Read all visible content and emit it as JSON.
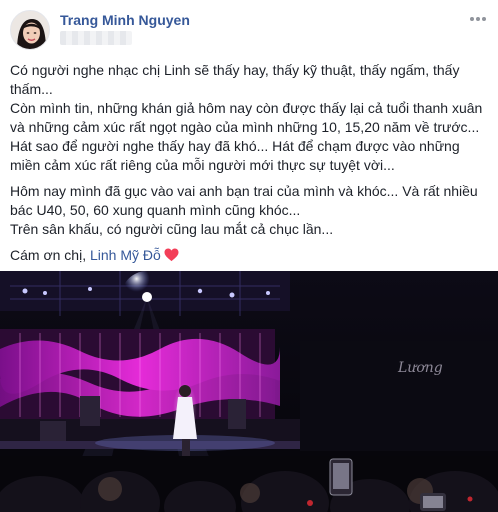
{
  "post": {
    "author_name": "Trang Minh Nguyen",
    "paragraphs": [
      {
        "lines": [
          "Có người nghe nhạc chị Linh sẽ thấy hay, thấy kỹ thuật, thấy ngấm, thấy",
          "thấm...",
          "Còn mình tin, những khán giả hôm nay còn được thấy lại cả tuổi thanh xuân",
          "và những cảm xúc rất ngọt ngào của mình những 10, 15,20 năm về trước...",
          "Hát sao để người nghe thấy hay đã khó... Hát để chạm được vào những",
          "miền cảm xúc rất riêng của mỗi người mới thực sự tuyệt vời..."
        ]
      },
      {
        "lines": [
          "Hôm nay mình đã gục vào vai anh bạn trai của mình và khóc... Và rất nhiều",
          "bác U40, 50, 60 xung quanh mình cũng khóc...",
          "Trên sân khấu, có người cũng lau mắt cả chục lần..."
        ]
      }
    ],
    "thanks_prefix": "Cám ơn chị, ",
    "mention": "Linh Mỹ Đỗ",
    "photo": {
      "description_icon": "concert-stage-photo",
      "backdrop_text": "Lương"
    }
  },
  "colors": {
    "author": "#365899",
    "text": "#1d2129",
    "heart": "#f33e58",
    "stage_glow": "#d21ec8"
  },
  "icons": {
    "more": "more-horizontal-icon",
    "heart": "heart-emoji-icon"
  }
}
